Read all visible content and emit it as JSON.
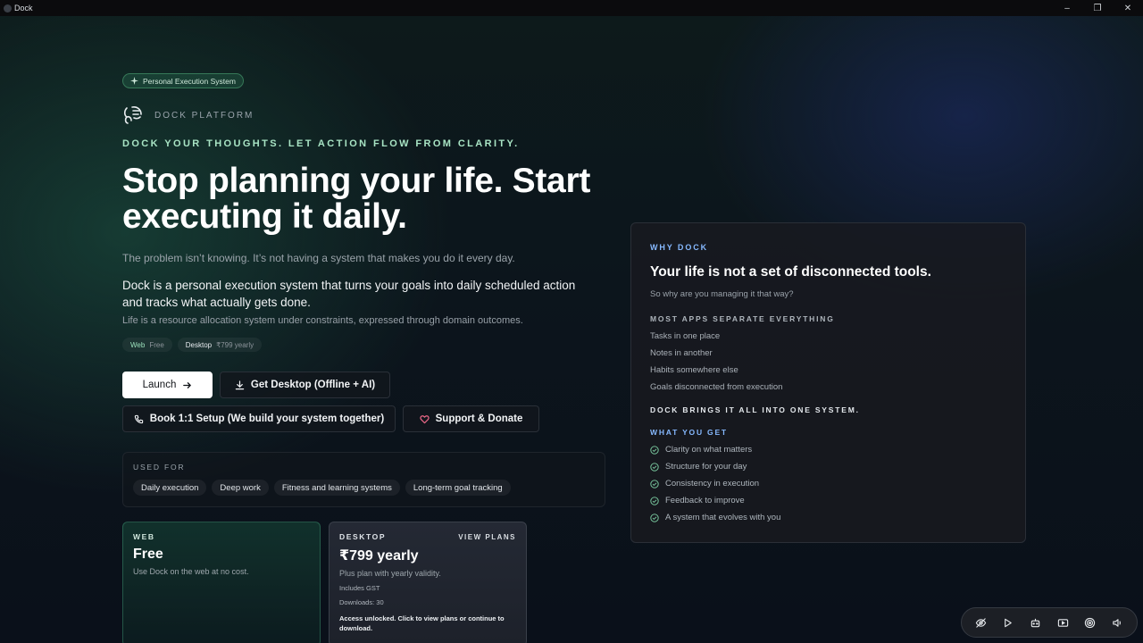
{
  "window": {
    "title": "Dock"
  },
  "hero": {
    "tag": "Personal Execution System",
    "brand": "DOCK PLATFORM",
    "tagline": "DOCK YOUR THOUGHTS. LET ACTION FLOW FROM CLARITY.",
    "headline": "Stop planning your life. Start executing it daily.",
    "problem": "The problem isn’t knowing. It’s not having a system that makes you do it every day.",
    "description": "Dock is a personal execution system that turns your goals into daily scheduled action and tracks what actually gets done.",
    "sub": "Life is a resource allocation system under constraints, expressed through domain outcomes."
  },
  "price_tags": [
    {
      "key": "Web",
      "value": "Free"
    },
    {
      "key": "Desktop",
      "value": "₹799 yearly"
    }
  ],
  "buttons": {
    "launch": "Launch",
    "get_desktop": "Get Desktop (Offline + AI)",
    "book_setup": "Book 1:1 Setup (We build your system together)",
    "support": "Support & Donate"
  },
  "used_for": {
    "label": "USED FOR",
    "chips": [
      "Daily execution",
      "Deep work",
      "Fitness and learning systems",
      "Long-term goal tracking"
    ]
  },
  "plans": {
    "web": {
      "label": "WEB",
      "price": "Free",
      "desc": "Use Dock on the web at no cost."
    },
    "desktop": {
      "label": "DESKTOP",
      "view_plans": "VIEW PLANS",
      "price": "₹799 yearly",
      "desc": "Plus plan with yearly validity.",
      "includes": "Includes GST",
      "downloads": "Downloads: 30",
      "note": "Access unlocked. Click to view plans or continue to download."
    }
  },
  "why": {
    "label": "WHY DOCK",
    "title": "Your life is not a set of disconnected tools.",
    "question": "So why are you managing it that way?",
    "separate_label": "MOST APPS SEPARATE EVERYTHING",
    "separate_items": [
      "Tasks in one place",
      "Notes in another",
      "Habits somewhere else",
      "Goals disconnected from execution"
    ],
    "brings": "DOCK BRINGS IT ALL INTO ONE SYSTEM.",
    "get_label": "WHAT YOU GET",
    "get_items": [
      "Clarity on what matters",
      "Structure for your day",
      "Consistency in execution",
      "Feedback to improve",
      "A system that evolves with you"
    ]
  },
  "colors": {
    "accent_green": "#a8e4c4",
    "accent_blue": "#86b9ff"
  },
  "icons": [
    "sparkle-icon",
    "dock-logo-icon",
    "arrow-right-icon",
    "download-icon",
    "phone-icon",
    "heart-icon",
    "check-circle-icon",
    "eye-off-icon",
    "play-icon",
    "robot-icon",
    "video-icon",
    "target-icon",
    "volume-icon"
  ]
}
